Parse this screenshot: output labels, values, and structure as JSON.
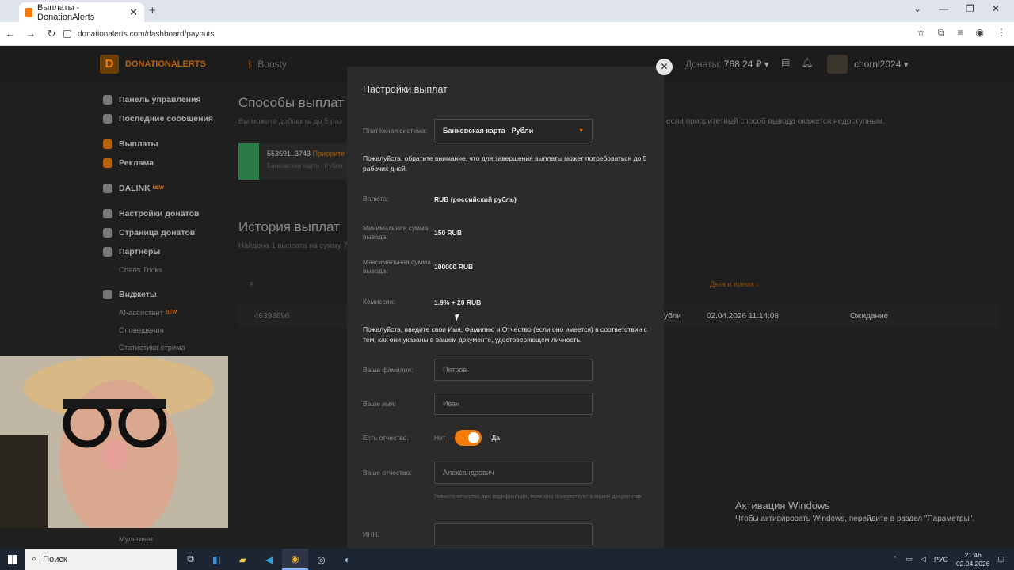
{
  "browser": {
    "tab_title": "Выплаты - DonationAlerts",
    "tab_close": "✕",
    "new_tab": "+",
    "url": "donationalerts.com/dashboard/payouts"
  },
  "header": {
    "logo_text": "DONATIONALERTS",
    "logo_mark": "D",
    "boosty": "Boosty",
    "donations_label": "Донаты:",
    "donations_value": "768,24 ₽ ▾",
    "username": "chornl2024 ▾"
  },
  "sidebar": {
    "items": [
      {
        "label": "Панель управления"
      },
      {
        "label": "Последние сообщения"
      },
      {
        "label": "Выплаты"
      },
      {
        "label": "Реклама"
      },
      {
        "label": "DALINK"
      },
      {
        "label": "Настройки донатов"
      },
      {
        "label": "Страница донатов"
      },
      {
        "label": "Партнёры"
      },
      {
        "label": "Chaos Tricks"
      },
      {
        "label": "Виджеты"
      },
      {
        "label": "AI-ассистент"
      },
      {
        "label": "Оповещения"
      },
      {
        "label": "Статистика стрима"
      }
    ],
    "new_badge": "NEW",
    "multichat": "Мультичат"
  },
  "main": {
    "title": "Способы выплат",
    "subtitle": "Вы можете добавить до 5 раз",
    "card_number": "553691..3743",
    "card_priority": "Приорите",
    "card_type": "Банковская карта - Рубли",
    "right_note": "если приоритетный способ вывода окажется недоступным.",
    "history_title": "История выплат",
    "history_subtitle": "Найдена 1 выплата на сумму 7",
    "col_num": "#",
    "col_date": "Дата и время ↓",
    "row_id": "46398696",
    "row_currency": "убли",
    "row_date": "02.04.2026 11:14:08",
    "row_status": "Ожидание"
  },
  "modal": {
    "close": "✕",
    "title": "Настройки выплат",
    "payment_system_label": "Платёжная система:",
    "payment_system_value": "Банковская карта - Рубли",
    "notice": "Пожалуйста, обратите внимание, что для завершения выплаты может потребоваться до 5 рабочих дней.",
    "currency_label": "Валюта:",
    "currency_value": "RUB (российский рубль)",
    "min_label": "Минимальная сумма вывода:",
    "min_value": "150 RUB",
    "max_label": "Максимальная сумма вывода:",
    "max_value": "100000 RUB",
    "fee_label": "Комиссия:",
    "fee_value": "1.9% + 20 RUB",
    "name_notice": "Пожалуйста, введите свои Имя, Фамилию и Отчество (если оно имеется) в соответствии с тем, как они указаны в вашем документе, удостоверяющем личность.",
    "surname_label": "Ваша фамилия:",
    "surname_placeholder": "Петров",
    "firstname_label": "Ваше имя:",
    "firstname_placeholder": "Иван",
    "patronymic_toggle_label": "Есть отчество:",
    "toggle_off": "Нет",
    "toggle_on": "Да",
    "toggle_state": true,
    "patronymic_label": "Ваше отчество:",
    "patronymic_placeholder": "Александрович",
    "patronymic_hint": "Укажите отчество для верификации, если оно присутствует в ваших документах",
    "inn_label": "ИНН:",
    "inn_value": ""
  },
  "windows_activation": {
    "title": "Активация Windows",
    "text": "Чтобы активировать Windows, перейдите в раздел \"Параметры\"."
  },
  "taskbar": {
    "search_placeholder": "Поиск",
    "language": "РУС",
    "time": "21:46",
    "date": "02.04.2026"
  }
}
